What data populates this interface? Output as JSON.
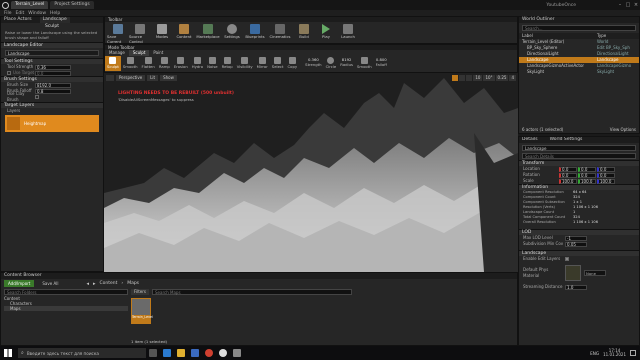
{
  "window": {
    "tabs": [
      "Terrain_Level",
      "Project Settings"
    ],
    "right_title": "YoutubeOnce",
    "menu": [
      "File",
      "Edit",
      "Window",
      "Help"
    ]
  },
  "modes": {
    "title": "Place Actors",
    "tab2": "Landscape",
    "tool_label": "Sculpt",
    "description": "Raise or lower the Landscape using the selected brush shape and falloff",
    "editor_section": "Landscape Editor",
    "landscape_value": "Landscape",
    "tool_settings": "Tool Settings",
    "tool_strength_label": "Tool Strength",
    "tool_strength_value": "0.36",
    "use_target_label": "Use Target",
    "use_target_value": "0.0",
    "brush_settings": "Brush Settings",
    "brush_size_label": "Brush Size",
    "brush_size_value": "8192.0",
    "brush_falloff_label": "Brush Falloff",
    "brush_falloff_value": "0.8",
    "clay_brush_label": "Use Clay Brush",
    "target_layers": "Target Layers",
    "layers_label": "Layers",
    "heightmap_label": "Heightmap"
  },
  "toolbar": {
    "title": "Toolbar",
    "buttons": [
      "Save Current",
      "Source Control",
      "Modes",
      "Content",
      "Marketplace",
      "Settings",
      "Blueprints",
      "Cinematics",
      "Build",
      "Play",
      "Launch"
    ]
  },
  "mode_toolbar": {
    "title": "Mode Toolbar",
    "tabs": [
      "Manage",
      "Sculpt",
      "Paint"
    ],
    "buttons": [
      "Sculpt",
      "Smooth",
      "Flatten",
      "Ramp",
      "Erosion",
      "Hydro",
      "Noise",
      "Retop",
      "Visibility",
      "Mirror",
      "Select",
      "Copy"
    ],
    "strength_value": "0.360",
    "strength_label": "Strength",
    "circle_label": "Circle",
    "radius_value": "8192",
    "radius_label": "Radius",
    "smooth_label": "Smooth",
    "falloff_value": "0.800",
    "falloff_label": "Falloff"
  },
  "viewport": {
    "perspective": "Perspective",
    "lit": "Lit",
    "show": "Show",
    "warning": "LIGHTING NEEDS TO BE REBUILT (500 unbuilt)",
    "warning_sub": "'DisableAllScreenMessages' to suppress",
    "snap_value": "10",
    "rot_value": "10°",
    "scale_value": "0.25",
    "cam_value": "4"
  },
  "outliner": {
    "title": "World Outliner",
    "search_placeholder": "Search...",
    "col_label": "Label",
    "col_type": "Type",
    "rows": [
      {
        "label": "Terrain_Level (Editor)",
        "type": "World"
      },
      {
        "label": "BP_Sky_Sphere",
        "type": "Edit BP_Sky_Sph"
      },
      {
        "label": "DirectionalLight",
        "type": "DirectionalLight"
      },
      {
        "label": "Landscape",
        "type": "Landscape"
      },
      {
        "label": "LandscapeGizmoActiveActor",
        "type": "LandscapeGizmo"
      },
      {
        "label": "SkyLight",
        "type": "SkyLight"
      }
    ],
    "footer": "6 actors (1 selected)",
    "view_options": "View Options"
  },
  "details": {
    "title": "Details",
    "world_settings": "World Settings",
    "actor_name": "Landscape",
    "search_placeholder": "Search Details",
    "transform": "Transform",
    "location_label": "Location",
    "rotation_label": "Rotation",
    "scale_label": "Scale",
    "location": [
      "0.0",
      "0.0",
      "0.0"
    ],
    "rotation": [
      "0.0",
      "0.0",
      "0.0"
    ],
    "scale": [
      "100.0",
      "100.0",
      "100.0"
    ],
    "information": "Information",
    "info_rows": [
      {
        "k": "Component Resolution",
        "v": "64 x 64"
      },
      {
        "k": "Component Count",
        "v": "324"
      },
      {
        "k": "Component Subsection",
        "v": "1 x 1"
      },
      {
        "k": "Resolution (Verts)",
        "v": "1 106 x 1 106"
      },
      {
        "k": "Landscape Count",
        "v": "1"
      },
      {
        "k": "Total Component Count",
        "v": "324"
      },
      {
        "k": "Overall Resolution",
        "v": "1 106 x 1 106"
      }
    ],
    "lod": "LOD",
    "max_lod_label": "Max LOD Level",
    "max_lod_value": "-1",
    "subsection_label": "Subdivision Min Cov",
    "subsection_value": "0.05",
    "landscape_section": "Landscape",
    "edit_layers_label": "Enable Edit Layers",
    "phys_label": "Default Phys Material",
    "phys_value": "None",
    "streaming_label": "Streaming Distance",
    "streaming_value": "1.0"
  },
  "content_browser": {
    "title": "Content Browser",
    "add_import": "Add/Import",
    "save_all": "Save All",
    "path": [
      "Content",
      "Maps"
    ],
    "search_folders": "Search Folders",
    "filters": "Filters",
    "search_maps": "Search Maps",
    "tree": [
      "Content",
      "Characters",
      "Maps"
    ],
    "asset_name": "Terrain_Level",
    "footer": "1 item (1 selected)"
  },
  "taskbar": {
    "search": "Введите здесь текст для поиска",
    "lang": "ENG",
    "time": "17:14",
    "date": "11.01.2021"
  }
}
